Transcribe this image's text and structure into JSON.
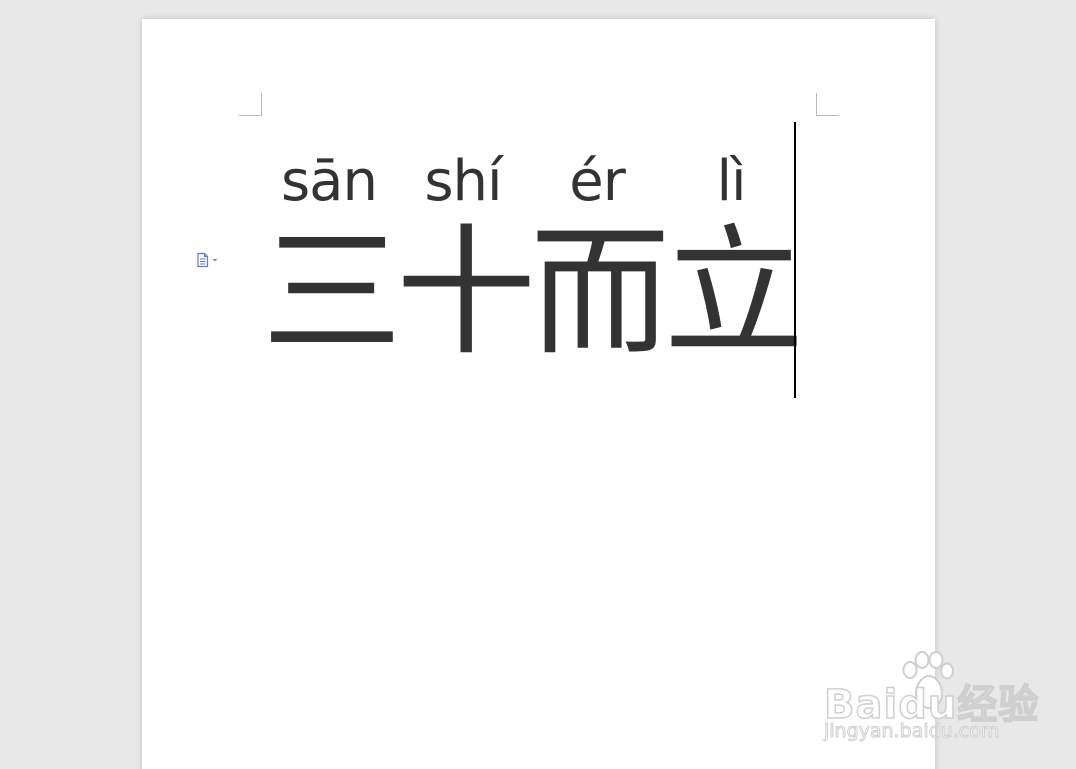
{
  "document": {
    "ruby_text": [
      {
        "pinyin": "sān",
        "hanzi": "三"
      },
      {
        "pinyin": "shí",
        "hanzi": "十"
      },
      {
        "pinyin": "ér",
        "hanzi": "而"
      },
      {
        "pinyin": "lì",
        "hanzi": "立"
      }
    ]
  },
  "toolbar": {
    "paste_options_icon": "paste-options-icon"
  },
  "watermark": {
    "brand": "Baidu经验",
    "url": "jingyan.baidu.com"
  },
  "colors": {
    "workspace": "#e8e8e8",
    "page": "#ffffff",
    "text": "#333333",
    "caret": "#000000",
    "icon_accent": "#5b7bd5"
  }
}
